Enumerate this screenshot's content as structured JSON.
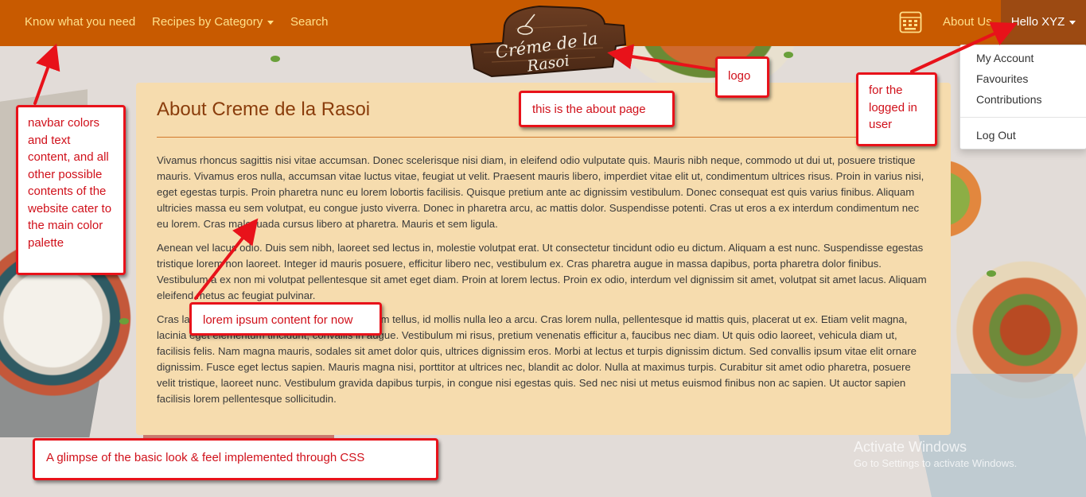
{
  "navbar": {
    "items": [
      "Know what you need",
      "Recipes by Category",
      "Search"
    ],
    "about": "About Us",
    "user_menu": "Hello XYZ",
    "color": "#c85a00",
    "link_color": "#ffe08a"
  },
  "logo": {
    "line1": "Créme de la",
    "line2": "Rasoi"
  },
  "user_dropdown": {
    "items": [
      "My Account",
      "Favourites",
      "Contributions"
    ],
    "logout": "Log Out"
  },
  "content": {
    "title": "About Creme de la Rasoi",
    "paragraphs": [
      "Vivamus rhoncus sagittis nisi vitae accumsan. Donec scelerisque nisi diam, in eleifend odio vulputate quis. Mauris nibh neque, commodo ut dui ut, posuere tristique mauris. Vivamus eros nulla, accumsan vitae luctus vitae, feugiat ut velit. Praesent mauris libero, imperdiet vitae elit ut, condimentum ultrices risus. Proin in varius nisi, eget egestas turpis. Proin pharetra nunc eu lorem lobortis facilisis. Quisque pretium ante ac dignissim vestibulum. Donec consequat est quis varius finibus. Aliquam ultricies massa eu sem volutpat, eu congue justo viverra. Donec in pharetra arcu, ac mattis dolor. Suspendisse potenti. Cras ut eros a ex interdum condimentum nec eu lorem. Cras malesuada cursus libero at pharetra. Mauris et sem ligula.",
      "Aenean vel lacus odio. Duis sem nibh, laoreet sed lectus in, molestie volutpat erat. Ut consectetur tincidunt odio eu dictum. Aliquam a est nunc. Suspendisse egestas tristique lorem non laoreet. Integer id mauris posuere, efficitur libero nec, vestibulum ex. Cras pharetra augue in massa dapibus, porta pharetra dolor finibus. Vestibulum a ex non mi volutpat pellentesque sit amet eget diam. Proin at lorem lectus. Proin ex odio, interdum vel dignissim sit amet, volutpat sit amet lacus. Aliquam eleifend metus ac feugiat pulvinar.",
      "Cras laoreet sed arcu eget interdum. Ut nec quam tellus, id mollis nulla leo a arcu. Cras lorem nulla, pellentesque id mattis quis, placerat ut ex. Etiam velit magna, lacinia eget elementum tincidunt, convallis in augue. Vestibulum mi risus, pretium venenatis efficitur a, faucibus nec diam. Ut quis odio laoreet, vehicula diam ut, facilisis felis. Nam magna mauris, sodales sit amet dolor quis, ultrices dignissim eros. Morbi at lectus et turpis dignissim dictum. Sed convallis ipsum vitae elit ornare dignissim. Fusce eget lectus sapien. Mauris magna nisi, porttitor at ultrices nec, blandit ac dolor. Nulla at maximus turpis. Curabitur sit amet odio pharetra, posuere velit tristique, laoreet nunc. Vestibulum gravida dapibus turpis, in congue nisi egestas quis. Sed nec nisi ut metus euismod finibus non ac sapien. Ut auctor sapien facilisis lorem pellentesque sollicitudin."
    ],
    "panel_color": "#f6dcae",
    "title_color": "#8a3d0c"
  },
  "annotations": {
    "navbar_note": "navbar colors and text content, and all other possible contents of the website cater to the main color palette",
    "logo_note": "logo",
    "about_note": "this is the about page",
    "user_note": "for the logged in user",
    "lorem_note": "lorem ipsum content for now",
    "css_note": "A glimpse of the basic look & feel implemented through CSS",
    "accent": "#e8121a"
  },
  "watermark": {
    "line1": "Activate Windows",
    "line2": "Go to Settings to activate Windows."
  },
  "icons": [
    "keyboard-icon",
    "caret-down-icon",
    "whisk-icon"
  ]
}
